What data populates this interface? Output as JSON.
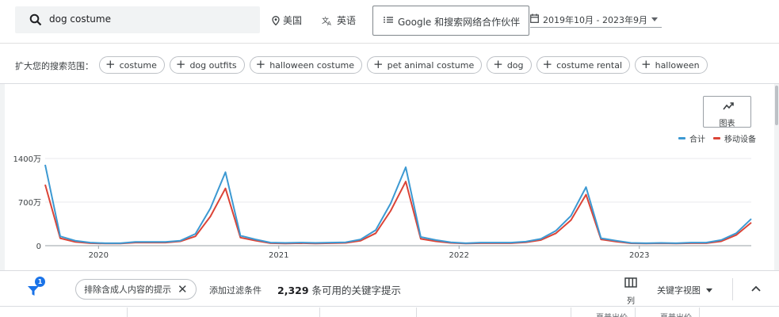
{
  "topbar": {
    "search_query": "dog costume",
    "location": "美国",
    "language": "英语",
    "network": "Google 和搜索网络合作伙伴",
    "date_range": "2019年10月 - 2023年9月"
  },
  "broaden": {
    "label": "扩大您的搜索范围：",
    "chips": [
      "costume",
      "dog outfits",
      "halloween costume",
      "pet animal costume",
      "dog",
      "costume rental",
      "halloween"
    ]
  },
  "chart_toggle_label": "图表",
  "legend": [
    {
      "name": "合计",
      "color": "#3c99d2"
    },
    {
      "name": "移动设备",
      "color": "#db4437"
    }
  ],
  "chart_data": {
    "type": "line",
    "x_tick_labels": [
      "2020",
      "2021",
      "2022",
      "2023"
    ],
    "y_tick_labels": [
      "1400万",
      "700万",
      "0"
    ],
    "ylim": [
      0,
      14000000
    ],
    "x": [
      "2019-10",
      "2019-11",
      "2019-12",
      "2020-01",
      "2020-02",
      "2020-03",
      "2020-04",
      "2020-05",
      "2020-06",
      "2020-07",
      "2020-08",
      "2020-09",
      "2020-10",
      "2020-11",
      "2020-12",
      "2021-01",
      "2021-02",
      "2021-03",
      "2021-04",
      "2021-05",
      "2021-06",
      "2021-07",
      "2021-08",
      "2021-09",
      "2021-10",
      "2021-11",
      "2021-12",
      "2022-01",
      "2022-02",
      "2022-03",
      "2022-04",
      "2022-05",
      "2022-06",
      "2022-07",
      "2022-08",
      "2022-09",
      "2022-10",
      "2022-11",
      "2022-12",
      "2023-01",
      "2023-02",
      "2023-03",
      "2023-04",
      "2023-05",
      "2023-06",
      "2023-07",
      "2023-08",
      "2023-09"
    ],
    "series": [
      {
        "name": "合计",
        "values": [
          13000000,
          1500000,
          800000,
          500000,
          400000,
          400000,
          600000,
          600000,
          600000,
          800000,
          1900000,
          6000000,
          11800000,
          1600000,
          1000000,
          500000,
          450000,
          500000,
          450000,
          500000,
          550000,
          1000000,
          2500000,
          6800000,
          12600000,
          1400000,
          900000,
          550000,
          400000,
          500000,
          500000,
          500000,
          650000,
          1100000,
          2400000,
          4800000,
          9400000,
          1200000,
          800000,
          450000,
          400000,
          450000,
          400000,
          500000,
          500000,
          900000,
          2000000,
          4300000
        ]
      },
      {
        "name": "移动设备",
        "values": [
          9800000,
          1200000,
          600000,
          400000,
          350000,
          350000,
          500000,
          500000,
          500000,
          700000,
          1500000,
          4700000,
          9200000,
          1300000,
          800000,
          400000,
          350000,
          400000,
          350000,
          400000,
          450000,
          800000,
          2000000,
          5600000,
          10300000,
          1100000,
          700000,
          450000,
          350000,
          400000,
          400000,
          400000,
          550000,
          900000,
          2000000,
          4100000,
          8200000,
          1000000,
          650000,
          380000,
          350000,
          380000,
          350000,
          400000,
          400000,
          700000,
          1700000,
          3700000
        ]
      }
    ]
  },
  "filterbar": {
    "badge": "1",
    "adult_filter": "排除含成人内容的提示",
    "add_filter": "添加过滤条件",
    "count": "2,329",
    "count_suffix": "条可用的关键字提示",
    "columns_label": "列",
    "view_label": "关键字视图"
  },
  "table_head": {
    "col_a": "夏普出价",
    "col_b": "夏普出价"
  }
}
